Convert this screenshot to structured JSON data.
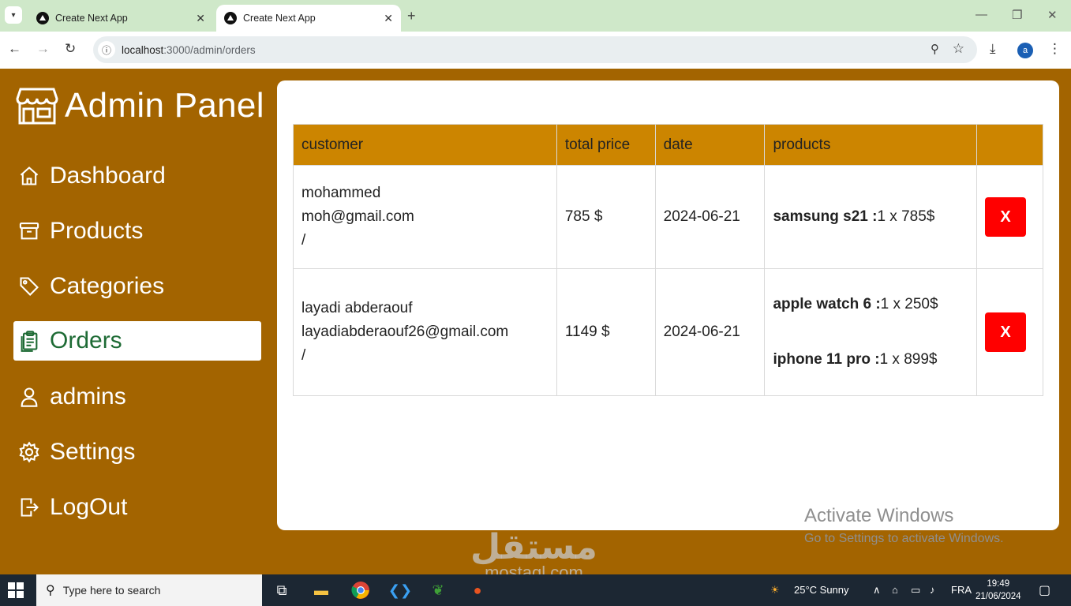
{
  "browser": {
    "tabs": [
      {
        "title": "Create Next App",
        "active": false
      },
      {
        "title": "Create Next App",
        "active": true
      }
    ],
    "url_host": "localhost",
    "url_path": ":3000/admin/orders",
    "profile_initial": "a"
  },
  "sidebar": {
    "brand": "Admin Panel",
    "items": [
      {
        "label": "Dashboard",
        "icon": "home-icon"
      },
      {
        "label": "Products",
        "icon": "archive-box-icon"
      },
      {
        "label": "Categories",
        "icon": "tag-icon"
      },
      {
        "label": "Orders",
        "icon": "clipboard-icon",
        "active": true
      },
      {
        "label": "admins",
        "icon": "user-icon"
      },
      {
        "label": "Settings",
        "icon": "gear-icon"
      },
      {
        "label": "LogOut",
        "icon": "logout-icon"
      }
    ]
  },
  "orders": {
    "headers": [
      "customer",
      "total price",
      "date",
      "products",
      ""
    ],
    "rows": [
      {
        "name": "mohammed",
        "email": "moh@gmail.com",
        "extra": "/",
        "total": "785 $",
        "date": "2024-06-21",
        "products": [
          {
            "name": "samsung s21 :",
            "qty": "1 x 785$"
          }
        ],
        "delete_label": "X"
      },
      {
        "name": "layadi abderaouf",
        "email": "layadiabderaouf26@gmail.com",
        "extra": "/",
        "total": "1149 $",
        "date": "2024-06-21",
        "products": [
          {
            "name": "apple watch 6 :",
            "qty": "1 x 250$"
          },
          {
            "name": "iphone 11 pro :",
            "qty": "1 x 899$"
          }
        ],
        "delete_label": "X"
      }
    ]
  },
  "watermarks": {
    "activate_title": "Activate Windows",
    "activate_sub": "Go to Settings to activate Windows.",
    "mostaql_ar": "مستقل",
    "mostaql_en": "mostaql.com"
  },
  "taskbar": {
    "search_placeholder": "Type here to search",
    "weather": "25°C  Sunny",
    "language": "FRA",
    "time": "19:49",
    "date": "21/06/2024"
  },
  "colors": {
    "sidebar_bg": "#a36400",
    "table_header": "#cc8500",
    "active_text": "#1e6b35",
    "delete_button": "#ff0000"
  }
}
